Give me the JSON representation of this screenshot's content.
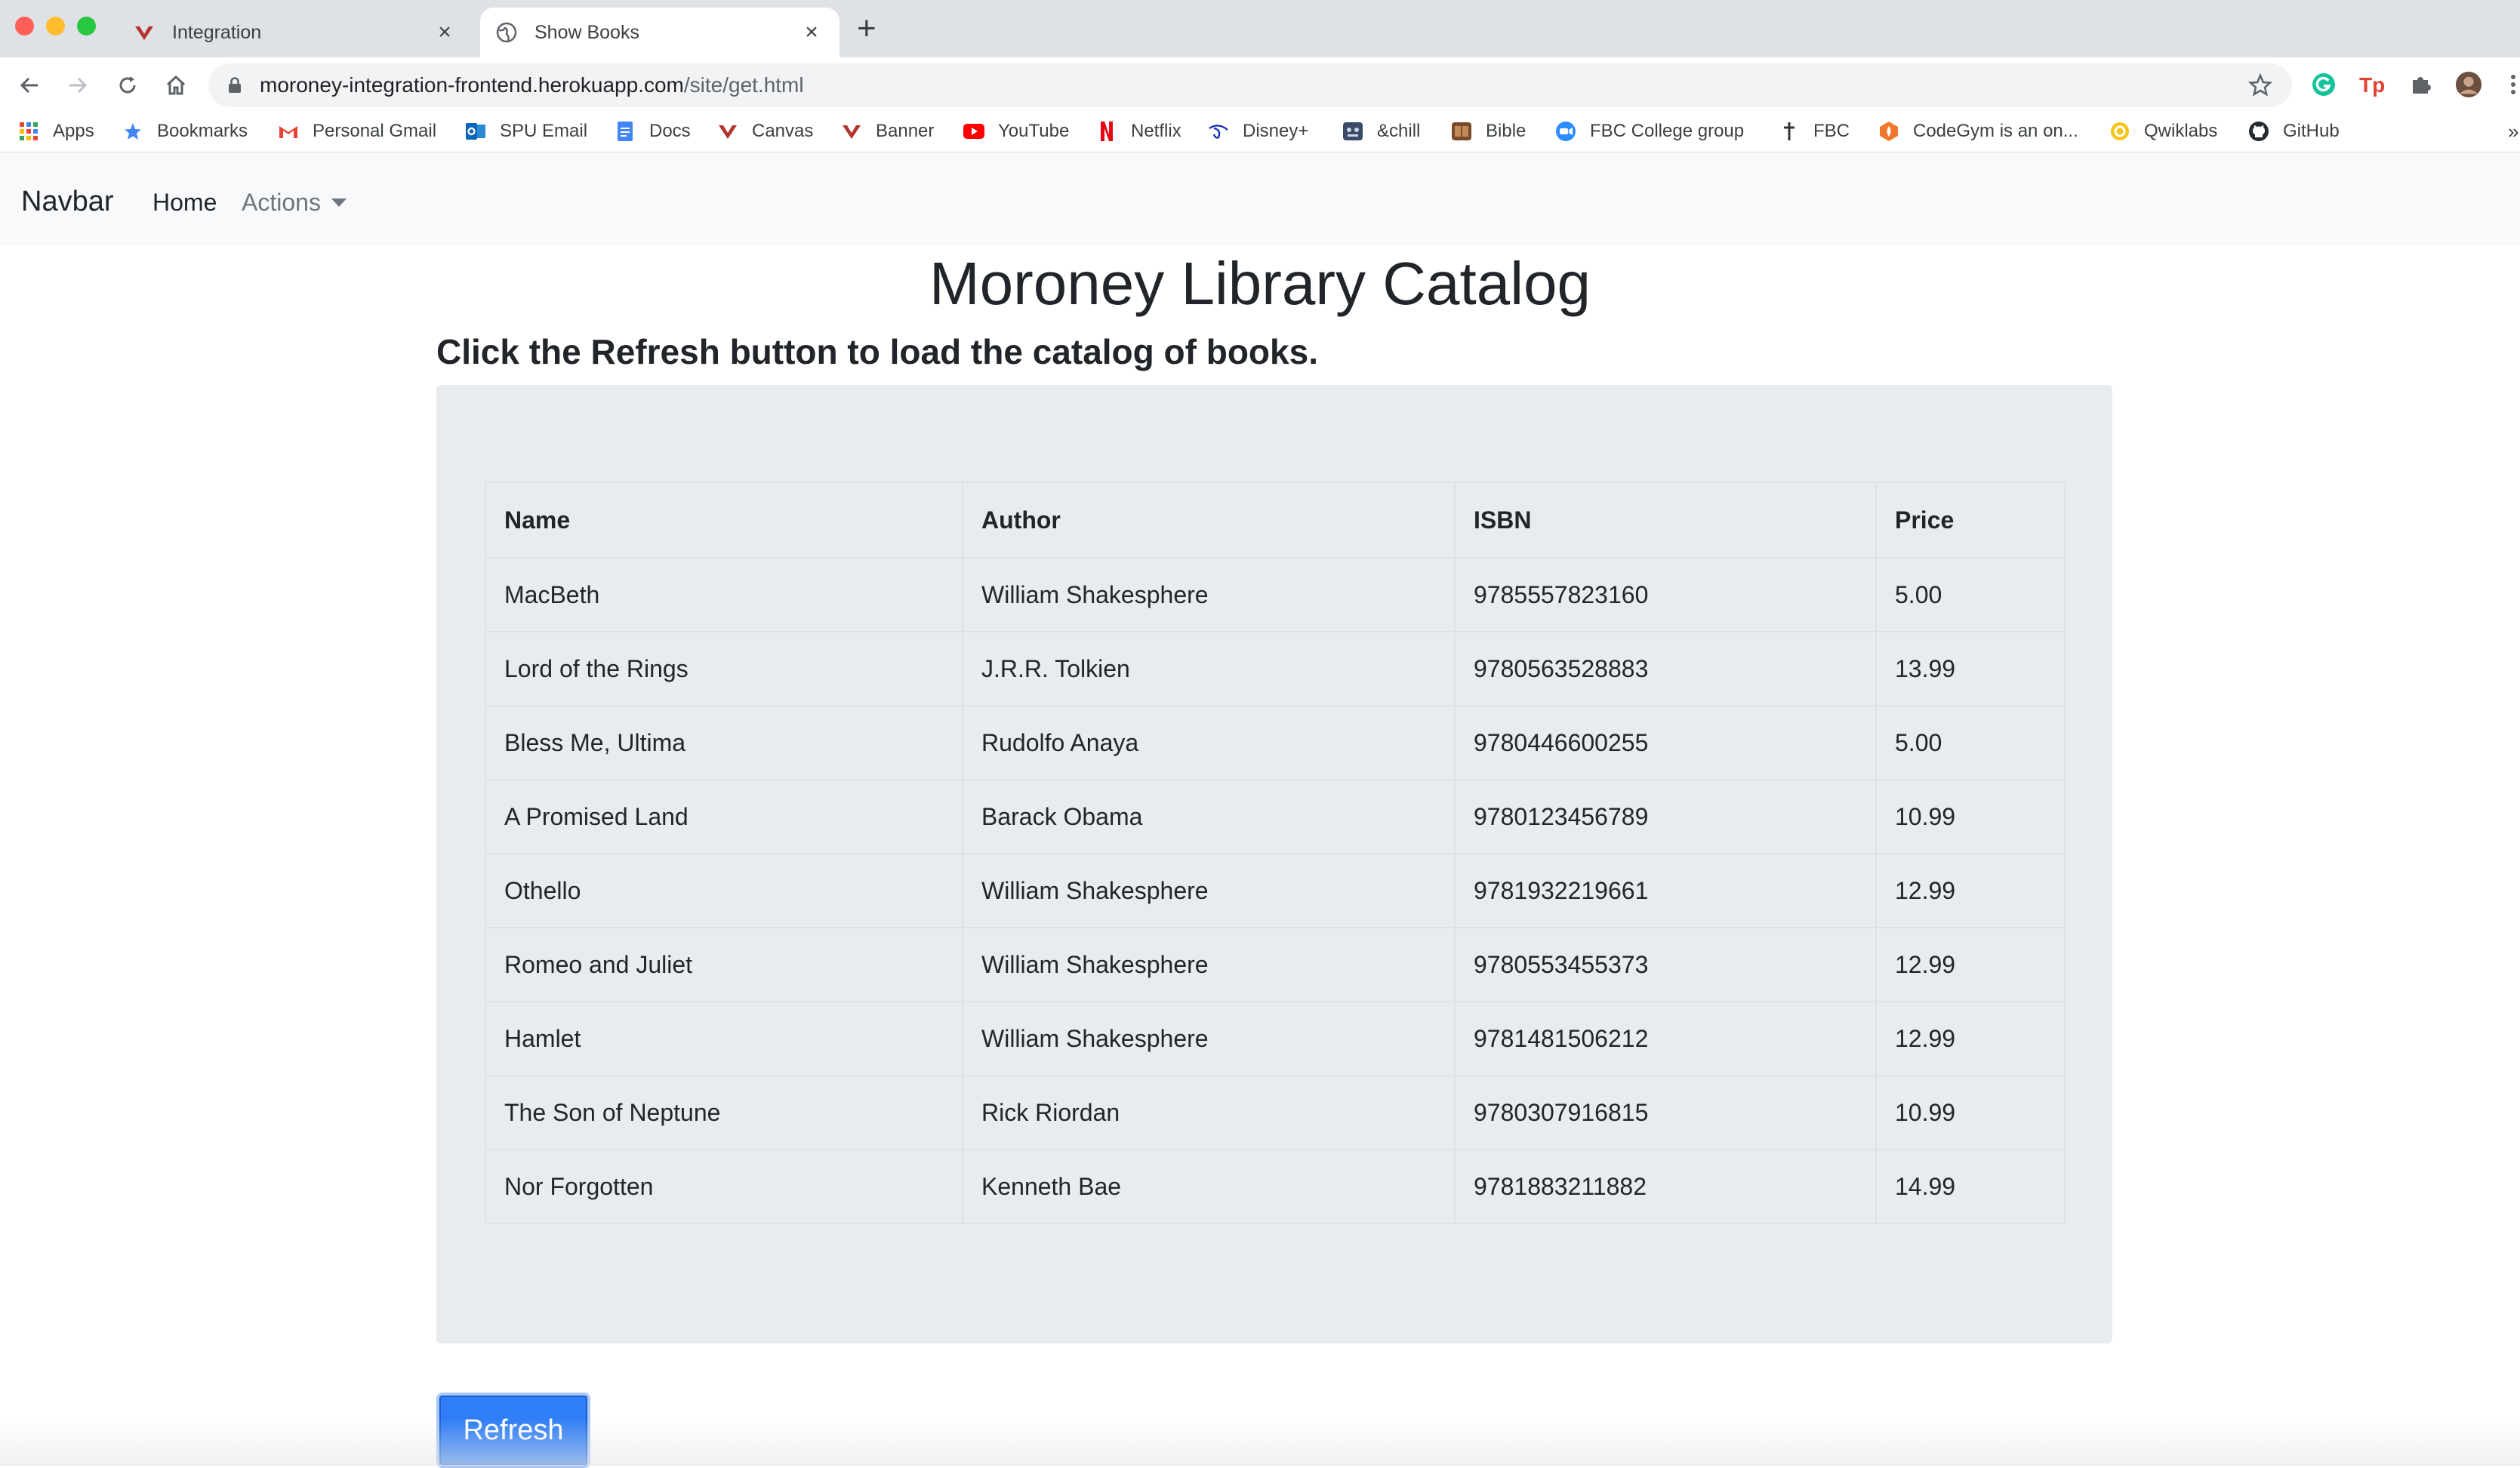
{
  "browser": {
    "tabs": [
      {
        "title": "Integration",
        "icon": "canvas-logo-icon"
      },
      {
        "title": "Show Books",
        "icon": "globe-icon"
      }
    ],
    "new_tab_label": "+",
    "address": {
      "host": "moroney-integration-frontend.herokuapp.com",
      "path": "/site/get.html"
    },
    "bookmarks": [
      {
        "label": "Apps",
        "icon": "apps-grid-icon"
      },
      {
        "label": "Bookmarks",
        "icon": "star-icon"
      },
      {
        "label": "Personal Gmail",
        "icon": "gmail-icon"
      },
      {
        "label": "SPU Email",
        "icon": "outlook-icon"
      },
      {
        "label": "Docs",
        "icon": "docs-icon"
      },
      {
        "label": "Canvas",
        "icon": "canvas-logo-icon"
      },
      {
        "label": "Banner",
        "icon": "canvas-logo-icon"
      },
      {
        "label": "YouTube",
        "icon": "youtube-icon"
      },
      {
        "label": "Netflix",
        "icon": "netflix-icon"
      },
      {
        "label": "Disney+",
        "icon": "disney-icon"
      },
      {
        "label": "&chill",
        "icon": "chill-icon"
      },
      {
        "label": "Bible",
        "icon": "bible-icon"
      },
      {
        "label": "FBC College group",
        "icon": "zoom-icon"
      },
      {
        "label": "FBC",
        "icon": "cross-icon"
      },
      {
        "label": "CodeGym is an on...",
        "icon": "codegym-icon"
      },
      {
        "label": "Qwiklabs",
        "icon": "qwiklabs-icon"
      },
      {
        "label": "GitHub",
        "icon": "github-icon"
      }
    ],
    "overflow_label": "»"
  },
  "navbar": {
    "brand": "Navbar",
    "home": "Home",
    "actions": "Actions"
  },
  "page": {
    "title": "Moroney Library Catalog",
    "subtitle": "Click the Refresh button to load the catalog of books.",
    "refresh_label": "Refresh"
  },
  "table": {
    "headers": [
      "Name",
      "Author",
      "ISBN",
      "Price"
    ],
    "rows": [
      [
        "MacBeth",
        "William Shakesphere",
        "9785557823160",
        "5.00"
      ],
      [
        "Lord of the Rings",
        "J.R.R. Tolkien",
        "9780563528883",
        "13.99"
      ],
      [
        "Bless Me, Ultima",
        "Rudolfo Anaya",
        "9780446600255",
        "5.00"
      ],
      [
        "A Promised Land",
        "Barack Obama",
        "9780123456789",
        "10.99"
      ],
      [
        "Othello",
        "William Shakesphere",
        "9781932219661",
        "12.99"
      ],
      [
        "Romeo and Juliet",
        "William Shakesphere",
        "9780553455373",
        "12.99"
      ],
      [
        "Hamlet",
        "William Shakesphere",
        "9781481506212",
        "12.99"
      ],
      [
        "The Son of Neptune",
        "Rick Riordan",
        "9780307916815",
        "10.99"
      ],
      [
        "Nor Forgotten",
        "Kenneth Bae",
        "9781883211882",
        "14.99"
      ]
    ]
  },
  "colors": {
    "primary": "#2f7ef5",
    "navbar_bg": "#f8f9fa",
    "panel_bg": "#e9ecef"
  }
}
